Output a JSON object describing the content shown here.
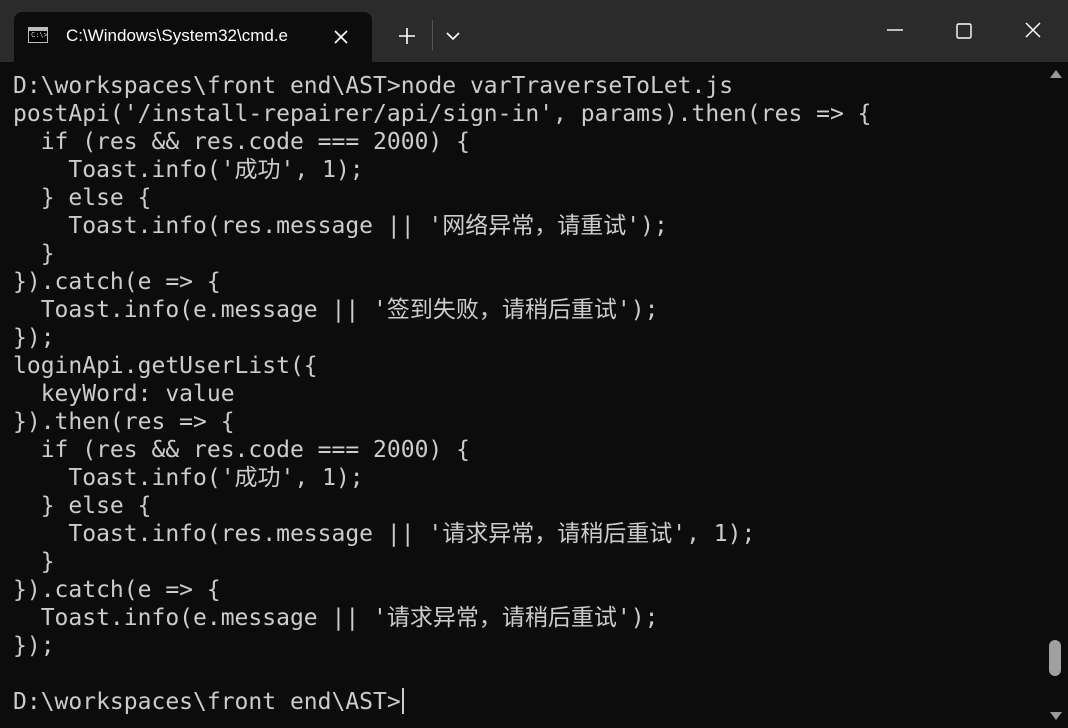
{
  "window": {
    "tab_title": "C:\\Windows\\System32\\cmd.e",
    "tab_icon_glyph": "C:\\>",
    "icons": {
      "tab": "console-icon",
      "tab_close": "close-icon",
      "new_tab": "plus-icon",
      "dropdown": "chevron-down-icon",
      "minimize": "minimize-icon",
      "maximize": "maximize-icon",
      "close": "close-icon"
    }
  },
  "terminal": {
    "lines": [
      "D:\\workspaces\\front end\\AST>node varTraverseToLet.js",
      "postApi('/install-repairer/api/sign-in', params).then(res => {",
      "  if (res && res.code === 2000) {",
      "    Toast.info('成功', 1);",
      "  } else {",
      "    Toast.info(res.message || '网络异常，请重试');",
      "  }",
      "}).catch(e => {",
      "  Toast.info(e.message || '签到失败，请稍后重试');",
      "});",
      "loginApi.getUserList({",
      "  keyWord: value",
      "}).then(res => {",
      "  if (res && res.code === 2000) {",
      "    Toast.info('成功', 1);",
      "  } else {",
      "    Toast.info(res.message || '请求异常，请稍后重试', 1);",
      "  }",
      "}).catch(e => {",
      "  Toast.info(e.message || '请求异常，请稍后重试');",
      "});",
      "",
      "D:\\workspaces\\front end\\AST>"
    ]
  },
  "colors": {
    "titlebar_bg": "#2b2b2b",
    "terminal_bg": "#0c0c0c",
    "text": "#cccccc"
  }
}
